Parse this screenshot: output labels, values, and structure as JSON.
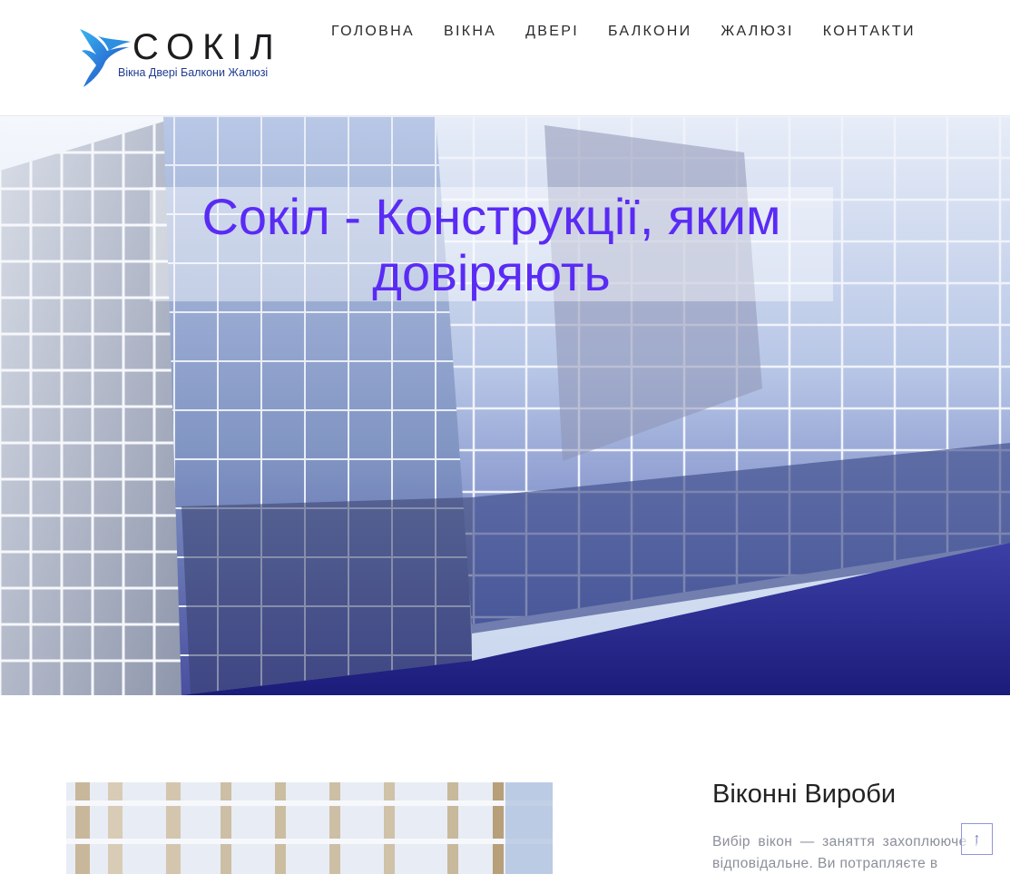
{
  "brand": {
    "logo_title": "СОКІЛ",
    "logo_subtitle": "Вікна Двері Балкони Жалюзі"
  },
  "nav": {
    "items": [
      {
        "label": "ГОЛОВНА"
      },
      {
        "label": "ВІКНА"
      },
      {
        "label": "ДВЕРІ"
      },
      {
        "label": "БАЛКОНИ"
      },
      {
        "label": "ЖАЛЮЗІ"
      },
      {
        "label": "КОНТАКТИ"
      }
    ]
  },
  "hero": {
    "title_line1": "Сокіл - Конструкції, яким",
    "title_line2": "довіряють"
  },
  "section": {
    "title": "Віконні Вироби",
    "text": "Вибір вікон — заняття захоплююче і відповідальне. Ви потрапляєте в"
  },
  "scroll_top": {
    "icon": "arrow-up-icon",
    "glyph": "↑"
  },
  "colors": {
    "accent": "#5a2bf5",
    "logo_blue": "#1f6fd6",
    "nav_text": "#2a2a2e",
    "body_text": "#8a8f99"
  }
}
